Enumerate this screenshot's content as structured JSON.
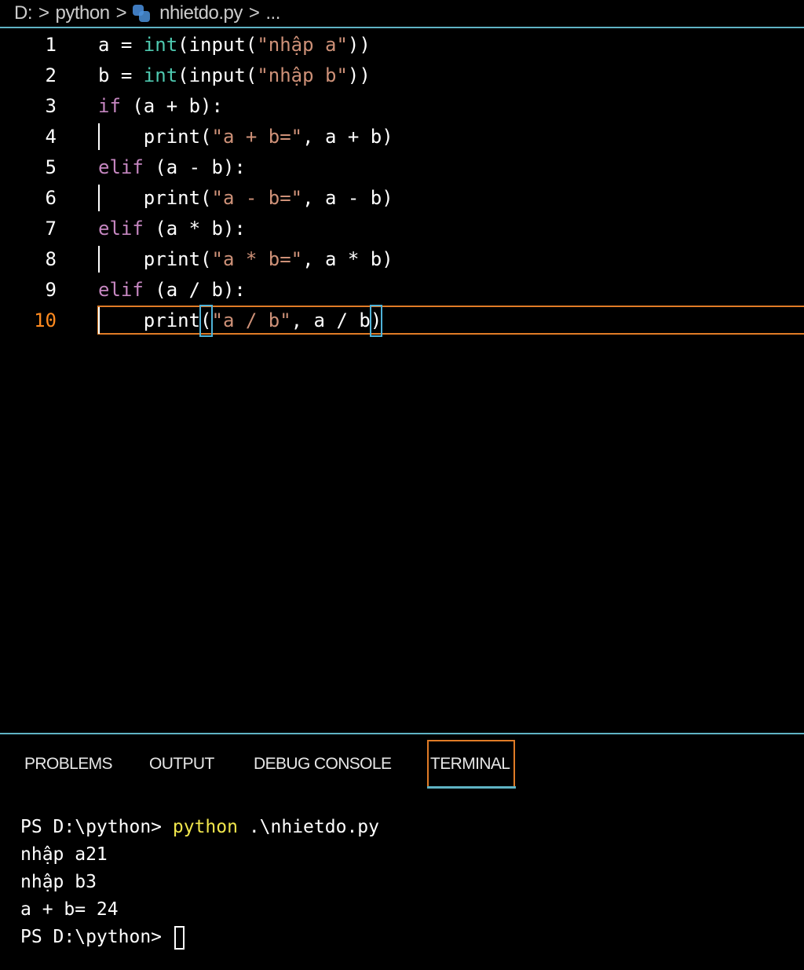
{
  "breadcrumb": {
    "drive": "D:",
    "folder": "python",
    "file": "nhietdo.py",
    "more": "...",
    "separator": ">"
  },
  "editor": {
    "active_line": 10,
    "lines": [
      {
        "num": "1",
        "tokens": [
          {
            "t": "a = ",
            "c": "plain"
          },
          {
            "t": "int",
            "c": "int"
          },
          {
            "t": "(input(",
            "c": "plain"
          },
          {
            "t": "\"nhập a\"",
            "c": "str"
          },
          {
            "t": "))",
            "c": "plain"
          }
        ]
      },
      {
        "num": "2",
        "tokens": [
          {
            "t": "b = ",
            "c": "plain"
          },
          {
            "t": "int",
            "c": "int"
          },
          {
            "t": "(input(",
            "c": "plain"
          },
          {
            "t": "\"nhập b\"",
            "c": "str"
          },
          {
            "t": "))",
            "c": "plain"
          }
        ]
      },
      {
        "num": "3",
        "tokens": [
          {
            "t": "if",
            "c": "kw"
          },
          {
            "t": " (a + b):",
            "c": "plain"
          }
        ]
      },
      {
        "num": "4",
        "tokens": [
          {
            "t": "    print(",
            "c": "plain"
          },
          {
            "t": "\"a + b=\"",
            "c": "str"
          },
          {
            "t": ", a + b)",
            "c": "plain"
          }
        ]
      },
      {
        "num": "5",
        "tokens": [
          {
            "t": "elif",
            "c": "kw"
          },
          {
            "t": " (a - b):",
            "c": "plain"
          }
        ]
      },
      {
        "num": "6",
        "tokens": [
          {
            "t": "    print(",
            "c": "plain"
          },
          {
            "t": "\"a - b=\"",
            "c": "str"
          },
          {
            "t": ", a - b)",
            "c": "plain"
          }
        ]
      },
      {
        "num": "7",
        "tokens": [
          {
            "t": "elif",
            "c": "kw"
          },
          {
            "t": " (a * b):",
            "c": "plain"
          }
        ]
      },
      {
        "num": "8",
        "tokens": [
          {
            "t": "    print(",
            "c": "plain"
          },
          {
            "t": "\"a * b=\"",
            "c": "str"
          },
          {
            "t": ", a * b)",
            "c": "plain"
          }
        ]
      },
      {
        "num": "9",
        "tokens": [
          {
            "t": "elif",
            "c": "kw"
          },
          {
            "t": " (a / b):",
            "c": "plain"
          }
        ]
      },
      {
        "num": "10",
        "tokens": [
          {
            "t": "    print",
            "c": "plain"
          },
          {
            "t": "(",
            "c": "bracket"
          },
          {
            "t": "\"a / b\"",
            "c": "str"
          },
          {
            "t": ", a / b",
            "c": "plain"
          },
          {
            "t": ")",
            "c": "bracket"
          }
        ]
      }
    ]
  },
  "panel": {
    "tabs": [
      {
        "label": "PROBLEMS"
      },
      {
        "label": "OUTPUT"
      },
      {
        "label": "DEBUG CONSOLE"
      },
      {
        "label": "TERMINAL"
      }
    ],
    "active_tab": "TERMINAL"
  },
  "terminal": {
    "prompt": "PS D:\\python> ",
    "command": "python",
    "command_args": " .\\nhietdo.py",
    "output": [
      "nhập a21",
      "nhập b3",
      "a + b= 24"
    ],
    "final_prompt": "PS D:\\python> "
  },
  "colors": {
    "keyword": "#c586c0",
    "builtin": "#4ec9b0",
    "string": "#ce9178",
    "active_line_number": "#ff8a1f",
    "focus_border": "#e07b26",
    "accent": "#5fb3c4",
    "terminal_command": "#f0e64c"
  }
}
